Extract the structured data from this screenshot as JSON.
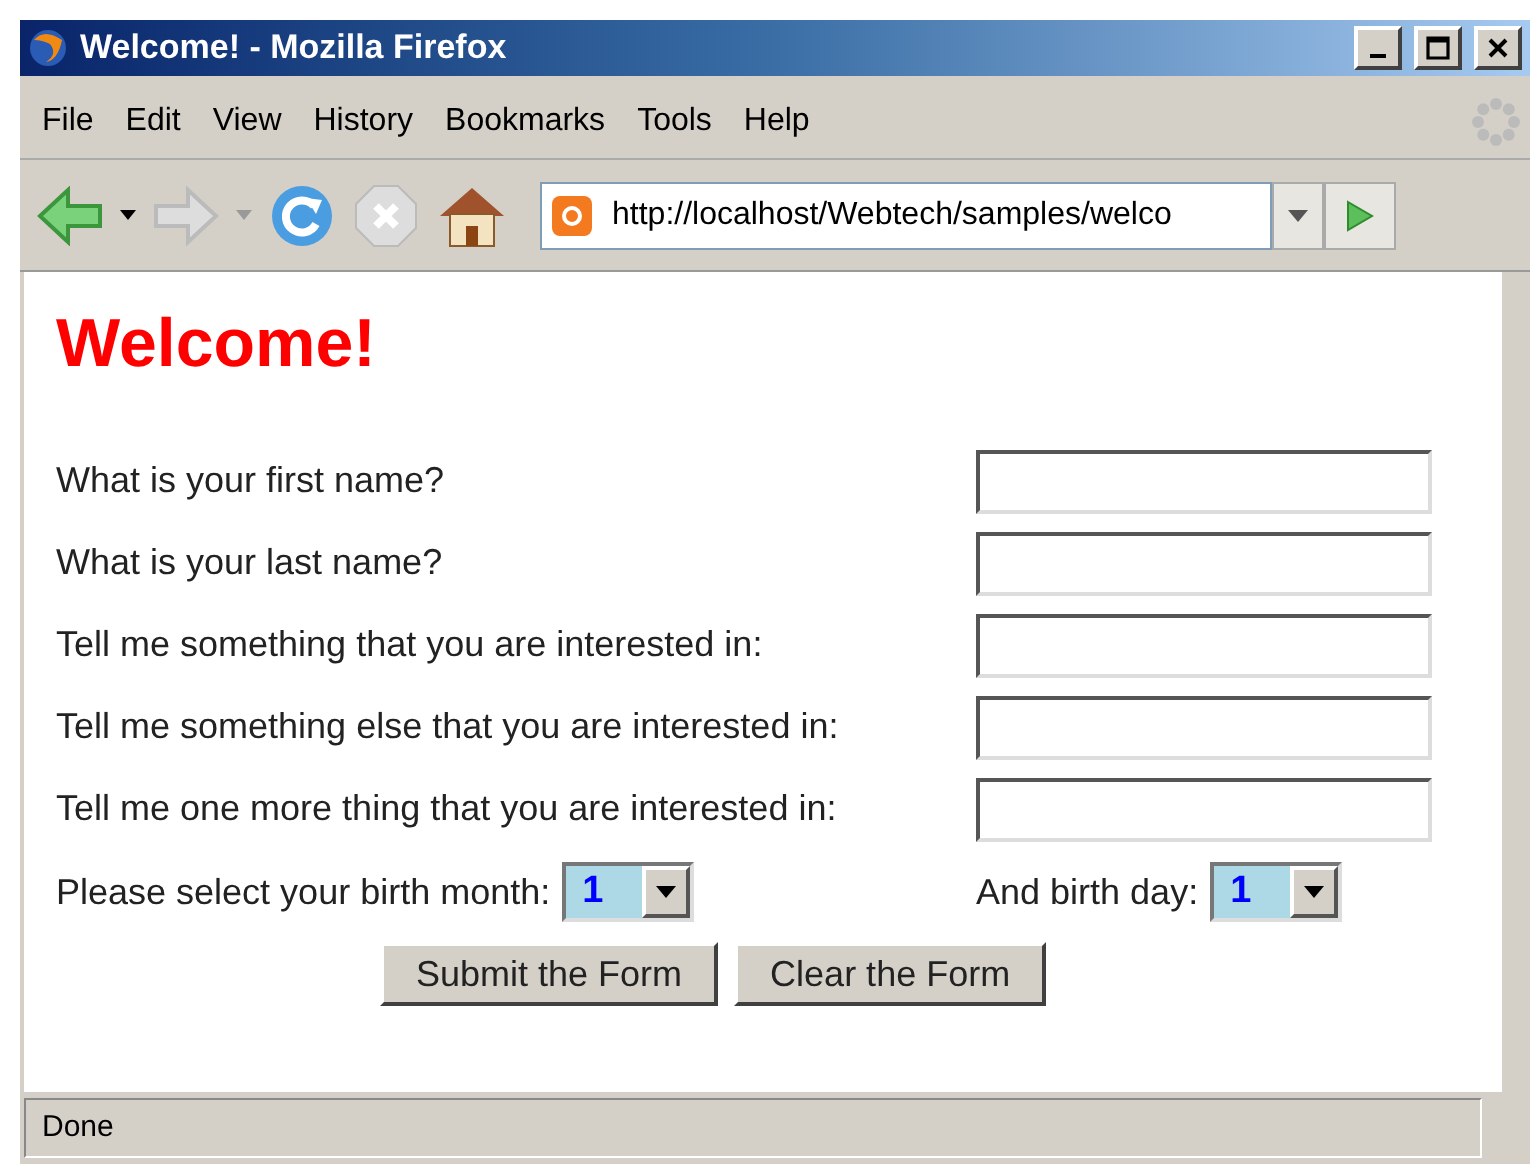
{
  "window": {
    "title": "Welcome! - Mozilla Firefox"
  },
  "menu": [
    "File",
    "Edit",
    "View",
    "History",
    "Bookmarks",
    "Tools",
    "Help"
  ],
  "address_bar": {
    "value": "http://localhost/Webtech/samples/welco"
  },
  "page": {
    "heading": "Welcome!",
    "fields": [
      {
        "label": "What is your first name?"
      },
      {
        "label": "What is your last name?"
      },
      {
        "label": "Tell me something that you are interested in:"
      },
      {
        "label": "Tell me something else that you are interested in:"
      },
      {
        "label": "Tell me one more thing that you are interested in:"
      }
    ],
    "month": {
      "label": "Please select your birth month:",
      "value": "1"
    },
    "day": {
      "label": "And birth day:",
      "value": "1"
    },
    "buttons": [
      "Submit the Form",
      "Clear the Form"
    ]
  },
  "status_bar": "Done"
}
